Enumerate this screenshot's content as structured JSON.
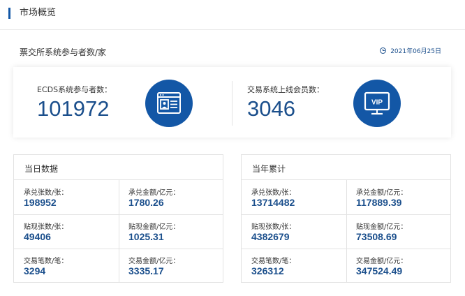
{
  "header": {
    "title": "市场概览"
  },
  "section": {
    "title": "票交所系统参与者数/家",
    "date": "2021年06月25日"
  },
  "stats": [
    {
      "label": "ECDS系统参与者数：",
      "value": "101972",
      "icon": "ecds-browser-icon"
    },
    {
      "label": "交易系统上线会员数：",
      "value": "3046",
      "icon": "vip-monitor-icon"
    }
  ],
  "daily": {
    "title": "当日数据",
    "cells": [
      {
        "label": "承兑张数/张：",
        "value": "198952"
      },
      {
        "label": "承兑金额/亿元：",
        "value": "1780.26"
      },
      {
        "label": "贴现张数/张：",
        "value": "49406"
      },
      {
        "label": "贴现金额/亿元：",
        "value": "1025.31"
      },
      {
        "label": "交易笔数/笔：",
        "value": "3294"
      },
      {
        "label": "交易金额/亿元：",
        "value": "3335.17"
      }
    ]
  },
  "yearly": {
    "title": "当年累计",
    "cells": [
      {
        "label": "承兑张数/张：",
        "value": "13714482"
      },
      {
        "label": "承兑金额/亿元：",
        "value": "117889.39"
      },
      {
        "label": "贴现张数/张：",
        "value": "4382679"
      },
      {
        "label": "贴现金额/亿元：",
        "value": "73508.69"
      },
      {
        "label": "交易笔数/笔：",
        "value": "326312"
      },
      {
        "label": "交易金额/亿元：",
        "value": "347524.49"
      }
    ]
  },
  "colors": {
    "accent": "#1357a6",
    "value_text": "#1b4f8c",
    "border": "#e2e2e2"
  }
}
